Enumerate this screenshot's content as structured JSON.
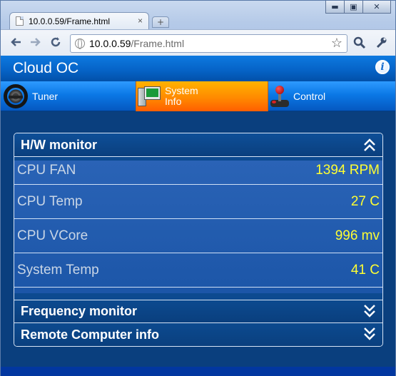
{
  "browser": {
    "tab_title": "10.0.0.59/Frame.html",
    "tab_close": "×",
    "new_tab": "+",
    "url_host": "10.0.0.59",
    "url_path": "/Frame.html",
    "window_buttons": {
      "minimize": "▬",
      "maximize": "▣",
      "close": "✕"
    },
    "nav_icons": [
      "back-icon",
      "forward-icon",
      "reload-icon"
    ],
    "toolbar_icons": [
      "bookmark-star-icon",
      "search-icon",
      "wrench-icon"
    ]
  },
  "app": {
    "title": "Cloud OC",
    "info_icon": "i",
    "nav": [
      {
        "label": "Tuner",
        "icon": "steering-wheel-icon",
        "active": false
      },
      {
        "label": "System\nInfo",
        "icon": "computer-icon",
        "active": true
      },
      {
        "label": "Control",
        "icon": "joystick-icon",
        "active": false
      }
    ],
    "sections": {
      "hw_monitor": {
        "title": "H/W monitor",
        "expanded": true,
        "rows": [
          {
            "label": "CPU FAN",
            "value": "1394 RPM"
          },
          {
            "label": "CPU Temp",
            "value": "27 C"
          },
          {
            "label": "CPU VCore",
            "value": "996 mv"
          },
          {
            "label": "System Temp",
            "value": "41 C"
          }
        ]
      },
      "frequency_monitor": {
        "title": "Frequency monitor",
        "expanded": false
      },
      "remote_computer_info": {
        "title": "Remote Computer info",
        "expanded": false
      }
    }
  },
  "colors": {
    "background": "#0a3f7e",
    "header": "#0664c8",
    "active_tab": "#ff8a00",
    "value_text": "#ffff33",
    "label_text": "#c9d6e6"
  }
}
